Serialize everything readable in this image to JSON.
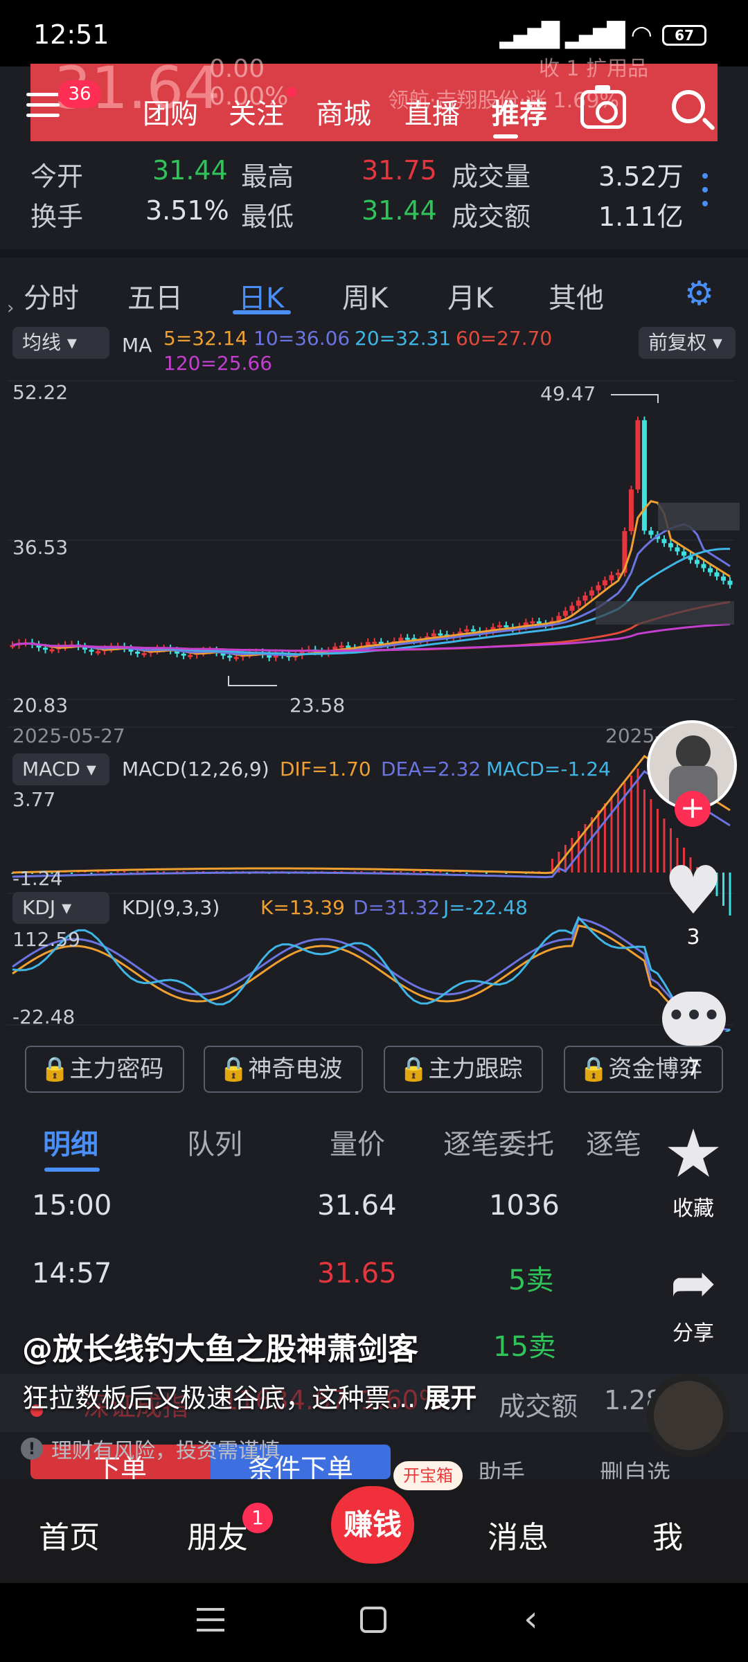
{
  "status_bar": {
    "time": "12:51",
    "battery": "67"
  },
  "top_nav": {
    "menu_badge": "36",
    "tabs": [
      "团购",
      "关注",
      "商城",
      "直播",
      "推荐"
    ],
    "ghost_price": "31.64",
    "ghost_change": "0.00\n0.00%",
    "ghost_right": "领航·吉翔股份·涨 1.69%",
    "ghost_ext": "收  1 扩用品"
  },
  "quote": {
    "open_label": "今开",
    "open_value": "31.44",
    "high_label": "最高",
    "high_value": "31.75",
    "volume_label": "成交量",
    "volume_value": "3.52万",
    "turnover_label": "换手",
    "turnover_value": "3.51%",
    "low_label": "最低",
    "low_value": "31.44",
    "amount_label": "成交额",
    "amount_value": "1.11亿"
  },
  "period_tabs": [
    "分时",
    "五日",
    "日K",
    "周K",
    "月K",
    "其他"
  ],
  "ma_bar": {
    "dropdown": "均线",
    "label": "MA",
    "ma5": "5=32.14",
    "ma10": "10=36.06",
    "ma20": "20=32.31",
    "ma60": "60=27.70",
    "ma120": "120=25.66",
    "adjust": "前复权"
  },
  "colors": {
    "ma5": "#f0a030",
    "ma10": "#6b74e0",
    "ma20": "#3fb6e6",
    "ma60": "#e24a3a",
    "ma120": "#c43fd0",
    "up": "#e6363d",
    "down": "#3ee0e0",
    "accent": "#4a8ff7"
  },
  "kline": {
    "price_max_label": "52.22",
    "price_mid_label": "36.53",
    "price_min_label": "20.83",
    "peak_label": "49.47",
    "low_label": "23.58",
    "date_start": "2025-05-27",
    "date_end": "2025-"
  },
  "macd": {
    "dropdown": "MACD",
    "params": "MACD(12,26,9)",
    "dif": "DIF=1.70",
    "dea": "DEA=2.32",
    "macd": "MACD=-1.24",
    "max_label": "3.77",
    "min_label": "-1.24"
  },
  "kdj": {
    "dropdown": "KDJ",
    "params": "KDJ(9,3,3)",
    "k": "K=13.39",
    "d": "D=31.32",
    "j": "J=-22.48",
    "max_label": "112.59",
    "min_label": "-22.48"
  },
  "lock_buttons": [
    "主力密码",
    "神奇电波",
    "主力跟踪",
    "资金博弈"
  ],
  "detail_tabs": [
    "明细",
    "队列",
    "量价",
    "逐笔委托",
    "逐笔"
  ],
  "trades": [
    {
      "time": "15:00",
      "price": "31.64",
      "vol": "1036"
    },
    {
      "time": "14:57",
      "price": "31.65",
      "vol": "5卖"
    },
    {
      "time": "",
      "price": "",
      "vol": "15卖"
    }
  ],
  "index_row": {
    "name": "深证成指",
    "value": "11634.67",
    "change": "1.60%",
    "amount_label": "成交额",
    "amount": "1.28"
  },
  "action_row": {
    "buy": "下单",
    "cond": "条件下单",
    "helper": "助手",
    "remove": "删自选"
  },
  "overlay": {
    "username": "@放长线钓大鱼之股神萧剑客",
    "caption": "狂拉数板后又极速谷底，这种票...",
    "expand": "展开",
    "risk": "理财有风险，投资需谨慎"
  },
  "side_actions": {
    "likes": "3",
    "comments": "7",
    "favorite": "收藏",
    "share": "分享"
  },
  "bottom_nav": {
    "home": "首页",
    "friends": "朋友",
    "friends_badge": "1",
    "earn": "赚钱",
    "earn_badge": "开宝箱",
    "messages": "消息",
    "me": "我"
  }
}
